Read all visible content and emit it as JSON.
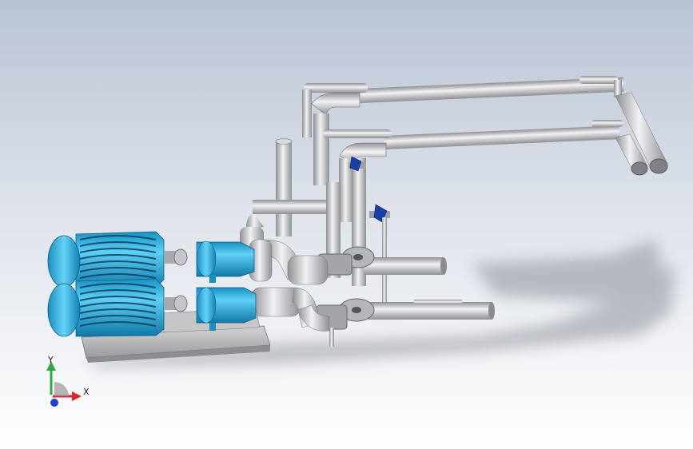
{
  "view": {
    "title": "",
    "background_top": "#b9c3d4",
    "background_bottom": "#ffffff"
  },
  "assembly": {
    "motor_color": "#2fb3e6",
    "pipe_color": "#c9c9cd",
    "valve_handle_color": "#1a3fa8",
    "base_color": "#bdbdc0"
  },
  "triad": {
    "x_label": "X",
    "y_label": "Y",
    "x_color": "#d8262d",
    "y_color": "#2fa84a",
    "z_color": "#2040d0"
  }
}
